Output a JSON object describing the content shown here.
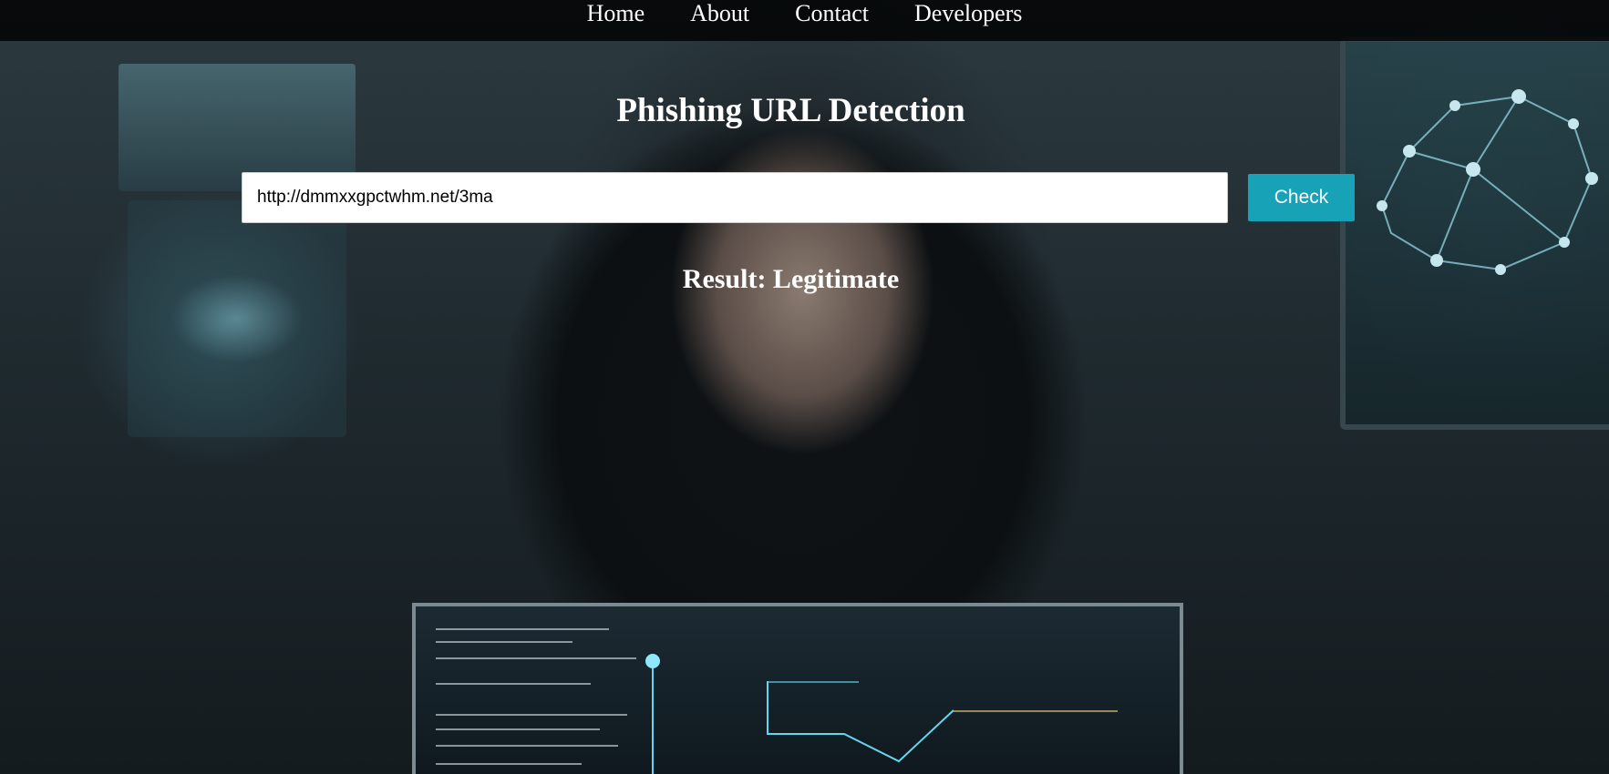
{
  "nav": {
    "items": [
      {
        "label": "Home"
      },
      {
        "label": "About"
      },
      {
        "label": "Contact"
      },
      {
        "label": "Developers"
      }
    ]
  },
  "main": {
    "title": "Phishing URL Detection",
    "url_input": {
      "value": "http://dmmxxgpctwhm.net/3ma"
    },
    "check_button_label": "Check",
    "result_text": "Result: Legitimate"
  },
  "colors": {
    "button_accent": "#17a2b8",
    "navbar_bg": "#000000",
    "text": "#ffffff"
  },
  "background": {
    "icon": "hooded-hacker-background-image"
  }
}
